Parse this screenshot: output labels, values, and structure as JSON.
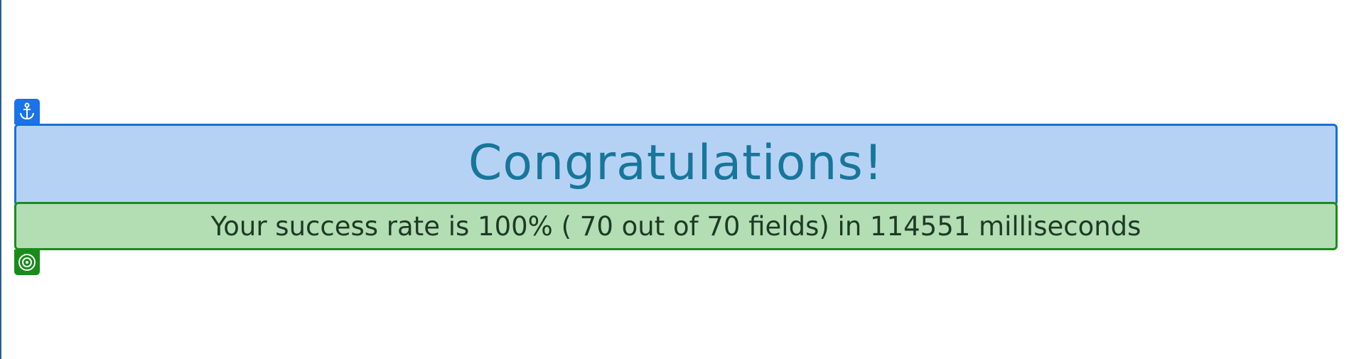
{
  "heading": {
    "text": "Congratulations!"
  },
  "result": {
    "text": "Your success rate is 100% ( 70 out of 70 fields) in 114551 milliseconds"
  },
  "badges": {
    "top_icon": "anchor-icon",
    "bottom_icon": "target-icon"
  },
  "colors": {
    "heading_bg": "#b5d2f5",
    "heading_border": "#1a6fd6",
    "heading_text": "#17769a",
    "result_bg": "#b3ddb3",
    "result_border": "#1e8a1e",
    "result_text": "#1d3a24"
  }
}
